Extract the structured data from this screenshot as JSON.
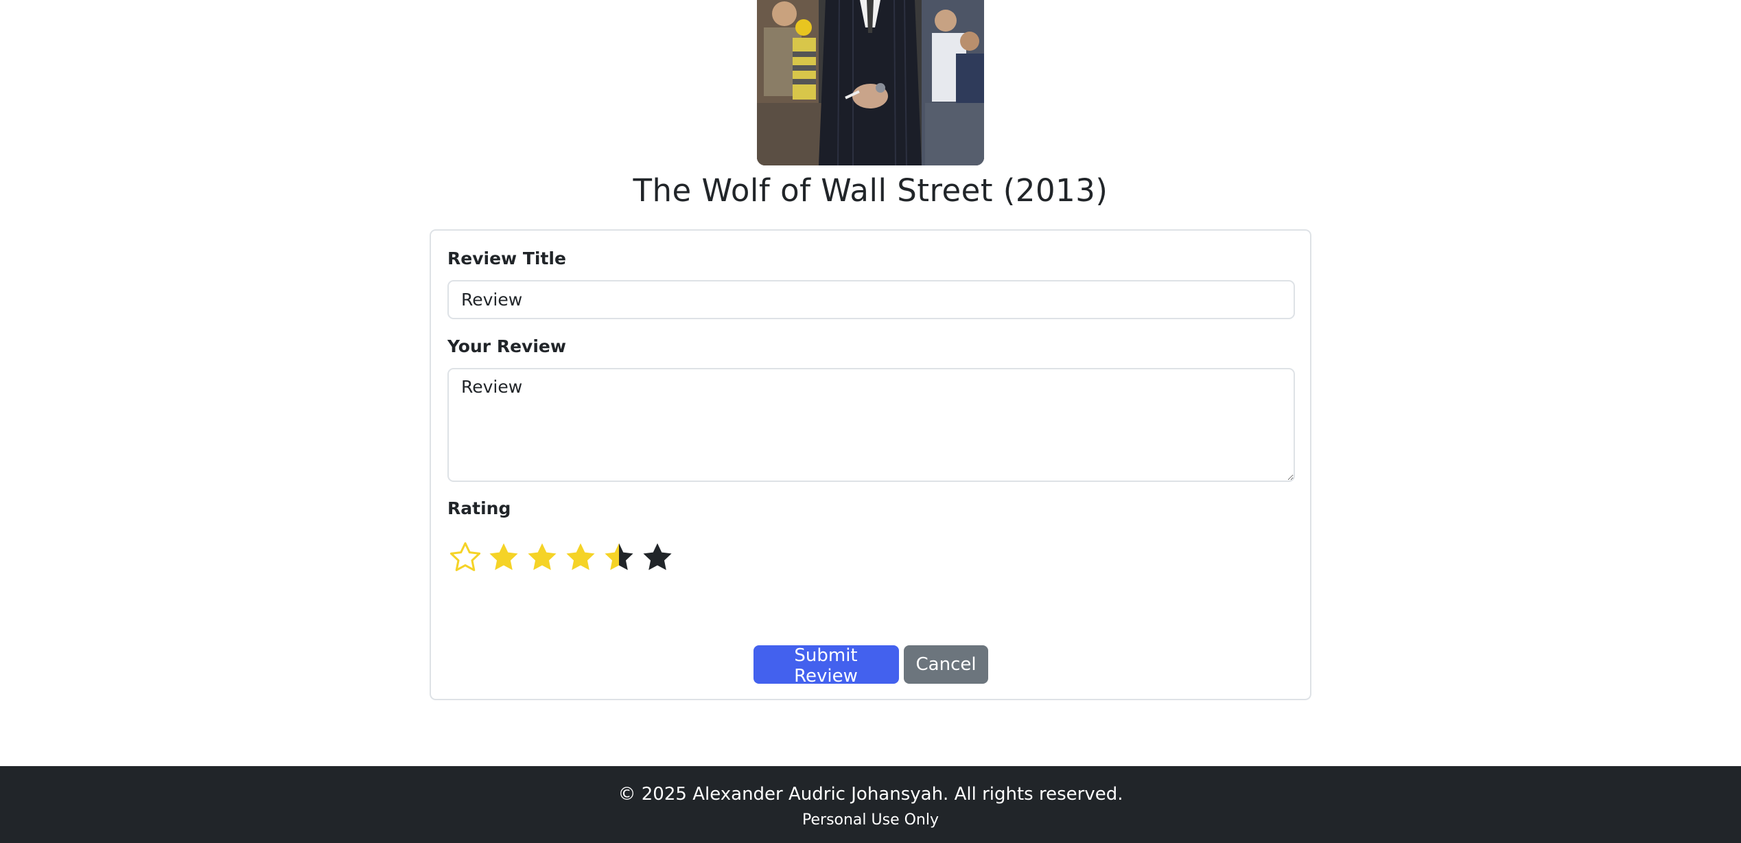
{
  "movie": {
    "title": "The Wolf of Wall Street (2013)"
  },
  "form": {
    "review_title_label": "Review Title",
    "review_title_value": "Review",
    "review_body_label": "Your Review",
    "review_body_value": "Review",
    "rating_label": "Rating",
    "rating_value": 4.5,
    "rating_max": 6,
    "star_fill_color": "#f5d327",
    "star_empty_color": "#212529"
  },
  "buttons": {
    "submit_label": "Submit Review",
    "cancel_label": "Cancel"
  },
  "footer": {
    "copyright": "© 2025 Alexander Audric Johansyah. All rights reserved.",
    "note": "Personal Use Only"
  }
}
